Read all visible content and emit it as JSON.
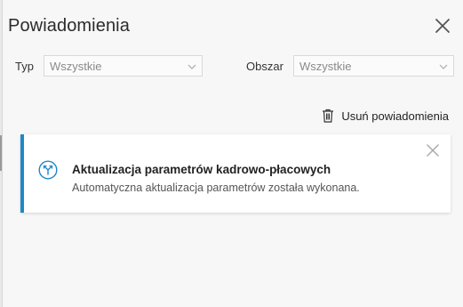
{
  "panel": {
    "title": "Powiadomienia"
  },
  "filters": {
    "type": {
      "label": "Typ",
      "value": "Wszystkie"
    },
    "area": {
      "label": "Obszar",
      "value": "Wszystkie"
    }
  },
  "actions": {
    "clear_label": "Usuń powiadomienia"
  },
  "notifications": [
    {
      "title": "Aktualizacja parametrów kadrowo-płacowych",
      "body": "Automatyczna aktualizacja parametrów została wykonana.",
      "accent_color": "#1e88c7"
    }
  ],
  "icons": {
    "close": "close-icon",
    "chevron": "chevron-down-icon",
    "trash": "trash-icon",
    "notification": "merge-arrows-icon"
  }
}
